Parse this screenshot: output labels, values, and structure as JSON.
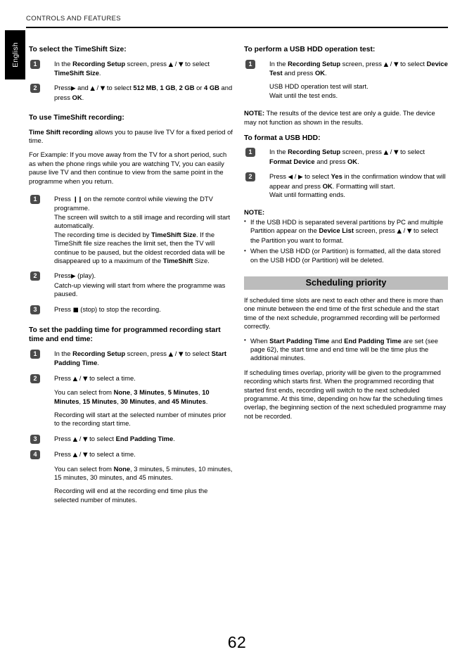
{
  "page": {
    "running_head": "CONTROLS AND FEATURES",
    "language_tab": "English",
    "folio": "62"
  },
  "left_column": {
    "s1": {
      "heading": "To select the TimeShift Size:",
      "steps": [
        {
          "num": "1",
          "lines": [
            "In the Recording Setup screen, press ▲ / ▼ to select TimeShift Size."
          ]
        },
        {
          "num": "2",
          "lines": [
            "Press ▶ and ▲ / ▼ to select 512 MB, 1 GB, 2 GB or 4 GB and press OK."
          ]
        }
      ]
    },
    "s2": {
      "heading": "To use TimeShift recording:",
      "p1_bold": "Time Shift recording",
      "p1_rest": " allows you to pause live TV for a fixed period of time.",
      "p2": "For Example: If you move away from the TV for a short period, such as when the phone rings while you are watching TV, you can easily pause live TV and then continue to view from the same point in the programme when you return.",
      "steps": [
        {
          "num": "1",
          "l1": "Press ▐▐ on the remote control while viewing the DTV programme.",
          "l2": "The screen will switch to a still image and recording will start automatically.",
          "l3": "The recording time is decided by TimeShift Size. If the TimeShift file size reaches the limit set, then the TV will continue to be paused, but the oldest recorded data will be disappeared up to a maximum of the TimeShift Size."
        },
        {
          "num": "2",
          "l1": "Press ▶ (play).",
          "l2": "Catch-up viewing will start from where the programme was paused."
        },
        {
          "num": "3",
          "l1": "Press ■ (stop) to stop the recording."
        }
      ]
    },
    "s3": {
      "heading": "To set the padding time for programmed recording start time and end time:",
      "steps": [
        {
          "num": "1",
          "l1": "In the Recording Setup screen, press ▲ / ▼ to select Start Padding Time."
        },
        {
          "num": "2",
          "l1": "Press ▲ / ▼ to select a time.",
          "l2": "You can select from None, 3 Minutes, 5 Minutes, 10 Minutes, 15 Minutes, 30 Minutes, and 45 Minutes.",
          "l3": "Recording will start at the selected number of minutes prior to the recording start time."
        },
        {
          "num": "3",
          "l1": "Press ▲ / ▼ to select End Padding Time."
        },
        {
          "num": "4",
          "l1": "Press ▲ / ▼ to select a time.",
          "l2": "You can select from None, 3 minutes, 5 minutes, 10 minutes, 15 minutes, 30 minutes, and 45 minutes.",
          "l3": "Recording will end at the recording end time plus the selected number of minutes."
        }
      ]
    }
  },
  "right_column": {
    "s1": {
      "heading": "To perform a USB HDD operation test:",
      "step": {
        "num": "1",
        "l1": "In the Recording Setup screen, press ▲ / ▼ to select Device Test and press OK.",
        "l2": "USB HDD operation test will start.",
        "l3": "Wait until the test ends."
      },
      "note_label": "NOTE:",
      "note_text": " The results of the device test are only a guide. The device may not function as shown in the results."
    },
    "s2": {
      "heading": "To format a USB HDD:",
      "steps": [
        {
          "num": "1",
          "l1": "In the Recording Setup screen, press ▲ / ▼ to select Format Device and press OK."
        },
        {
          "num": "2",
          "l1": "Press ◀ / ▶ to select Yes in the confirmation window that will appear and press OK. Formatting will start.",
          "l2": "Wait until formatting ends."
        }
      ],
      "note_label": "NOTE:",
      "bullets": [
        "If the USB HDD is separated several partitions by PC and multiple Partition appear on the Device List screen, press ▲ / ▼ to select the Partition you want to format.",
        "When the USB HDD (or Partition) is formatted, all the data stored on the USB HDD (or Partition) will be deleted."
      ]
    },
    "s3": {
      "banner": "Scheduling priority",
      "p1": "If scheduled time slots are next to each other and there is more than one minute between the end time of the first schedule and the start time of the next schedule, programmed recording will be performed correctly.",
      "bullet1": "When Start Padding Time and End Padding Time are set (see page 62), the start time and end time will be the time plus the additional minutes.",
      "p2": "If scheduling times overlap, priority will be given to the programmed recording which starts first. When the programmed recording that started first ends, recording will switch to the next scheduled programme. At this time, depending on how far the scheduling times overlap, the beginning section of the next scheduled programme may not be recorded."
    }
  }
}
